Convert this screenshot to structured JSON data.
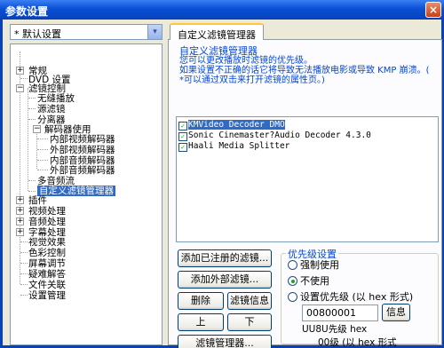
{
  "window": {
    "title": "参数设置",
    "close": "×"
  },
  "preset": {
    "value": "* 默认设置",
    "arrow": "▾"
  },
  "tree": {
    "items": [
      {
        "label": "常规",
        "expander": "+"
      },
      {
        "label": "DVD 设置"
      },
      {
        "label": "滤镜控制",
        "expander": "−"
      },
      {
        "label": "无缝播放"
      },
      {
        "label": "源滤镜"
      },
      {
        "label": "分离器"
      },
      {
        "label": "解码器使用",
        "expander": "−"
      },
      {
        "label": "内部视频解码器"
      },
      {
        "label": "外部视频解码器"
      },
      {
        "label": "内部音频解码器"
      },
      {
        "label": "外部音频解码器"
      },
      {
        "label": "多音频流"
      },
      {
        "label": "自定义滤镜管理器"
      },
      {
        "label": "插件",
        "expander": "+"
      },
      {
        "label": "视频处理",
        "expander": "+"
      },
      {
        "label": "音频处理",
        "expander": "+"
      },
      {
        "label": "字幕处理",
        "expander": "+"
      },
      {
        "label": "视觉效果"
      },
      {
        "label": "色彩控制"
      },
      {
        "label": "屏幕调节"
      },
      {
        "label": "疑难解答"
      },
      {
        "label": "文件关联"
      },
      {
        "label": "设置管理"
      }
    ]
  },
  "tab": {
    "label": "自定义滤镜管理器"
  },
  "panel": {
    "heading": "自定义滤镜管理器",
    "desc_line1": "您可以更改播放时滤镜的优先级。",
    "desc_line2": "如果设置不正确的话它将导致无法播放电影或导致 KMP 崩溃。(",
    "desc_line3": "*可以通过双击来打开滤镜的属性页。)"
  },
  "filters": [
    {
      "name": "KMVideo Decoder DMO",
      "checked": true,
      "selected": true
    },
    {
      "name": "Sonic Cinemaster?Audio Decoder 4.3.0",
      "checked": true,
      "selected": false
    },
    {
      "name": "Haali Media Splitter",
      "checked": true,
      "selected": false
    }
  ],
  "check_glyph": "✓",
  "buttons": {
    "add_registered": "添加已注册的滤镜...",
    "add_external": "添加外部滤镜...",
    "delete": "删除",
    "filter_info": "滤镜信息",
    "up": "上",
    "down": "下",
    "filter_manager": "滤镜管理器...",
    "info": "信息"
  },
  "priority": {
    "legend": "优先级设置",
    "force": "强制使用",
    "never": "不使用",
    "custom": "设置优先级 (以 hex 形式)",
    "value": "00800001",
    "overlap1": "UU8U先级 hex",
    "overlap2": "00级 (以 hex 形式"
  }
}
